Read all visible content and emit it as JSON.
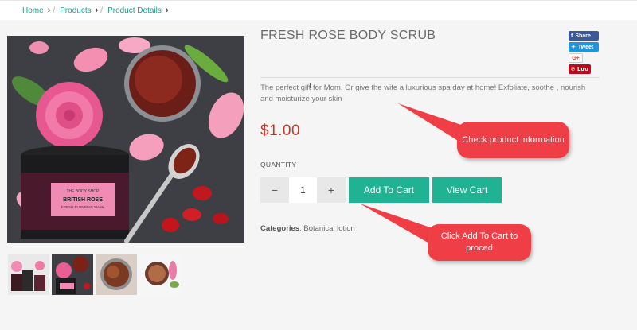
{
  "breadcrumb": {
    "items": [
      {
        "label": "Home"
      },
      {
        "label": "Products"
      },
      {
        "label": "Product Details"
      }
    ]
  },
  "product": {
    "title": "FRESH ROSE BODY SCRUB",
    "description": "The perfect gift for Mom. Or give the wife a luxurious spa day at home! Exfoliate, soothe , nourish and moisturize your skin",
    "price": "$1.00",
    "quantity_label": "QUANTITY",
    "quantity": "1",
    "decrement": "−",
    "increment": "+",
    "categories_label": "Categories",
    "categories_value": ": Botanical lotion",
    "jar_brand": "THE BODY SHOP",
    "jar_name": "BRITISH ROSE",
    "jar_sub": "FRESH PLUMPING MASK"
  },
  "social": {
    "facebook": "Share",
    "twitter": "Tweet",
    "google": "G+",
    "pinterest": "Lưu"
  },
  "buttons": {
    "add_to_cart": "Add To Cart",
    "view_cart": "View Cart"
  },
  "annotations": {
    "info": "Check product information",
    "cart": "Click Add To Cart to proced"
  },
  "colors": {
    "accent": "#1fb394",
    "price": "#c0392b",
    "callout": "#ef3e45"
  }
}
